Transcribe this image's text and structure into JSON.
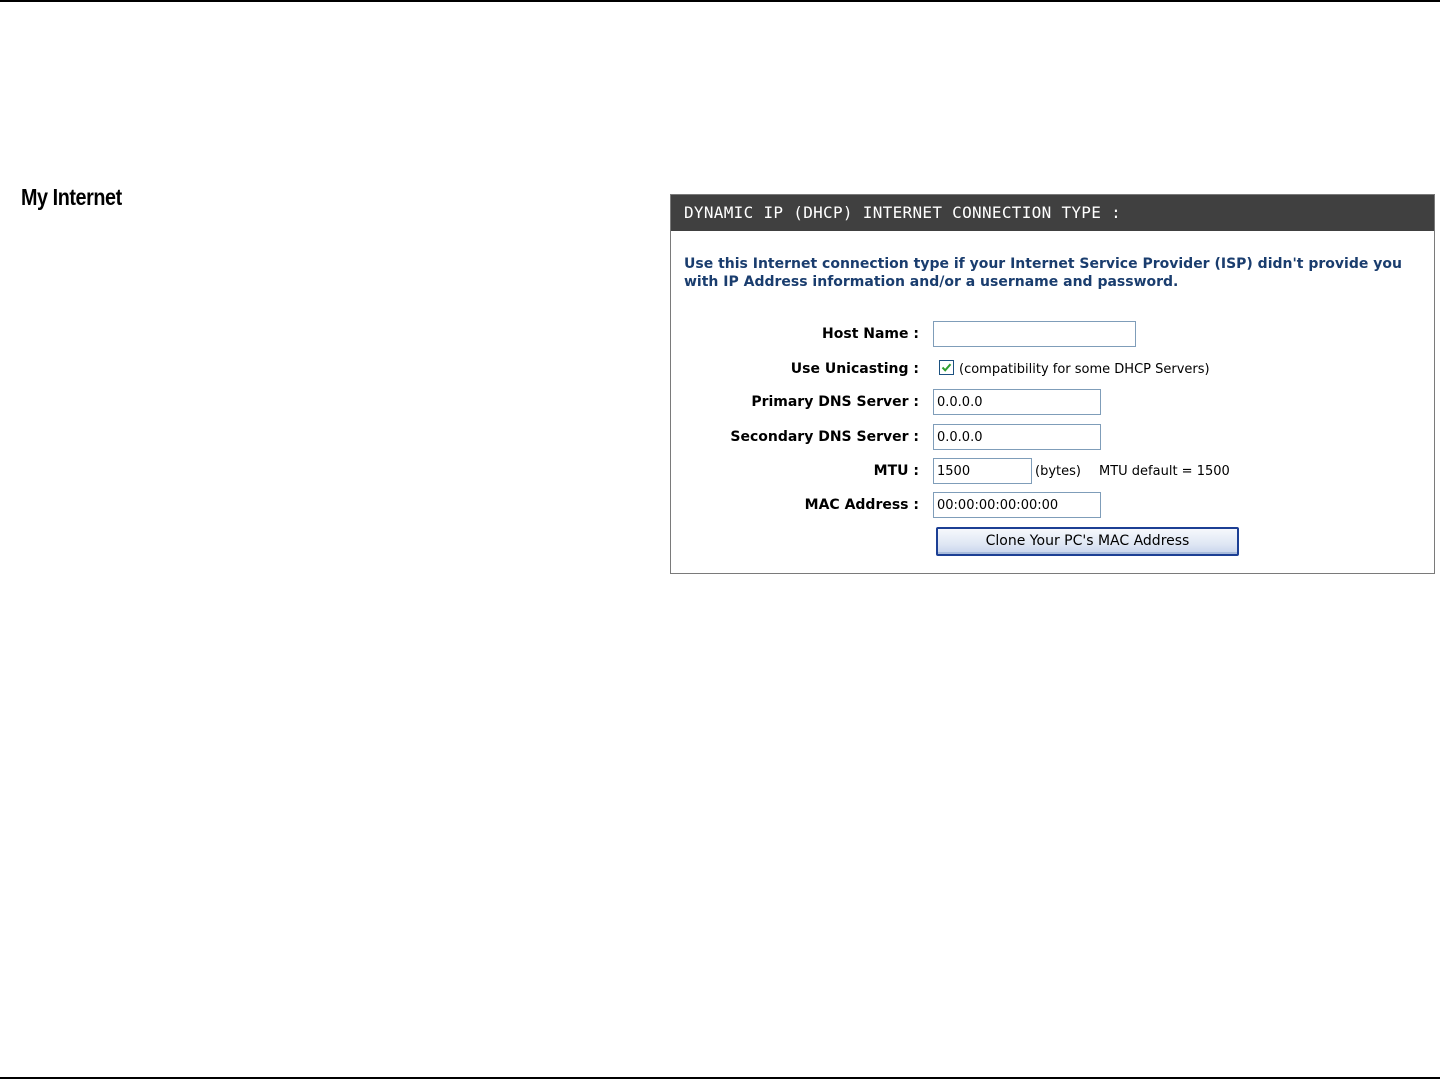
{
  "page": {
    "section_title": "My Internet"
  },
  "panel": {
    "header": "DYNAMIC IP (DHCP) INTERNET CONNECTION TYPE :",
    "description": "Use this Internet connection type if your Internet Service Provider (ISP) didn't provide you with IP Address information and/or a username and password.",
    "fields": {
      "host_name": {
        "label": "Host Name :",
        "value": ""
      },
      "use_unicasting": {
        "label": "Use Unicasting :",
        "checked": true,
        "note": "(compatibility for some DHCP Servers)"
      },
      "primary_dns": {
        "label": "Primary DNS Server :",
        "value": "0.0.0.0"
      },
      "secondary_dns": {
        "label": "Secondary DNS Server :",
        "value": "0.0.0.0"
      },
      "mtu": {
        "label": "MTU :",
        "value": "1500",
        "unit": "(bytes)",
        "default_note": "MTU default = 1500"
      },
      "mac_address": {
        "label": "MAC Address :",
        "value": "00:00:00:00:00:00"
      }
    },
    "clone_button_label": "Clone Your PC's MAC Address"
  },
  "colors": {
    "header_bg": "#404040",
    "description_text": "#1a3d6e",
    "checkbox_check": "#2e9e2e",
    "button_border": "#1c3f94"
  },
  "icons": {
    "checkbox": "checkmark-icon"
  }
}
